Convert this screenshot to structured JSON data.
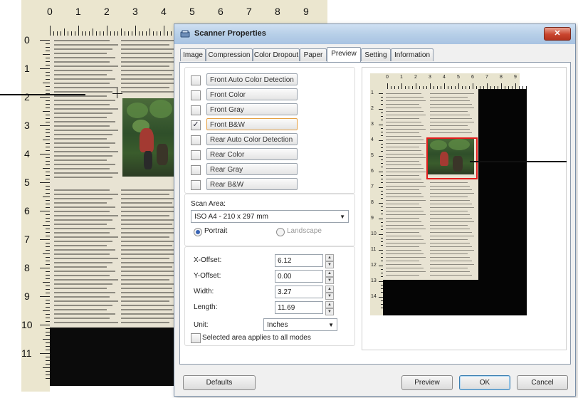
{
  "ruler": {
    "top_numbers": [
      "0",
      "1",
      "2",
      "3",
      "4",
      "5",
      "6",
      "7",
      "8",
      "9"
    ],
    "left_numbers": [
      "0",
      "1",
      "2",
      "3",
      "4",
      "5",
      "6",
      "7",
      "8",
      "9",
      "10",
      "11"
    ]
  },
  "dialog": {
    "title": "Scanner Properties",
    "close_symbol": "✕",
    "tabs": [
      "Image",
      "Compression",
      "Color Dropout",
      "Paper",
      "Preview",
      "Setting",
      "Information"
    ],
    "active_tab": "Preview",
    "modes": [
      {
        "label": "Front Auto Color Detection",
        "checked": false
      },
      {
        "label": "Front Color",
        "checked": false
      },
      {
        "label": "Front Gray",
        "checked": false
      },
      {
        "label": "Front B&W",
        "checked": true
      },
      {
        "label": "Rear Auto Color Detection",
        "checked": false
      },
      {
        "label": "Rear Color",
        "checked": false
      },
      {
        "label": "Rear Gray",
        "checked": false
      },
      {
        "label": "Rear B&W",
        "checked": false
      }
    ],
    "check_mark": "✓",
    "scan_area": {
      "label": "Scan Area:",
      "value": "ISO A4 - 210 x 297 mm",
      "portrait": "Portrait",
      "landscape": "Landscape",
      "orientation": "Portrait"
    },
    "fields": [
      {
        "label": "X-Offset:",
        "value": "6.12"
      },
      {
        "label": "Y-Offset:",
        "value": "0.00"
      },
      {
        "label": "Width:",
        "value": "3.27"
      },
      {
        "label": "Length:",
        "value": "11.69"
      }
    ],
    "unit": {
      "label": "Unit:",
      "value": "Inches"
    },
    "apply_all": {
      "label": "Selected area applies to all modes",
      "checked": false
    },
    "preview_ruler_top": [
      "0",
      "1",
      "2",
      "3",
      "4",
      "5",
      "6",
      "7",
      "8",
      "9"
    ],
    "preview_ruler_left": [
      "1",
      "2",
      "3",
      "4",
      "5",
      "6",
      "7",
      "8",
      "9",
      "10",
      "11",
      "12",
      "13",
      "14"
    ],
    "buttons": {
      "defaults": "Defaults",
      "preview": "Preview",
      "ok": "OK",
      "cancel": "Cancel"
    },
    "colors": {
      "selection": "#e21c1c",
      "title_bar": "#b7cfe8",
      "selected_mode_border": "#e5a043"
    }
  }
}
